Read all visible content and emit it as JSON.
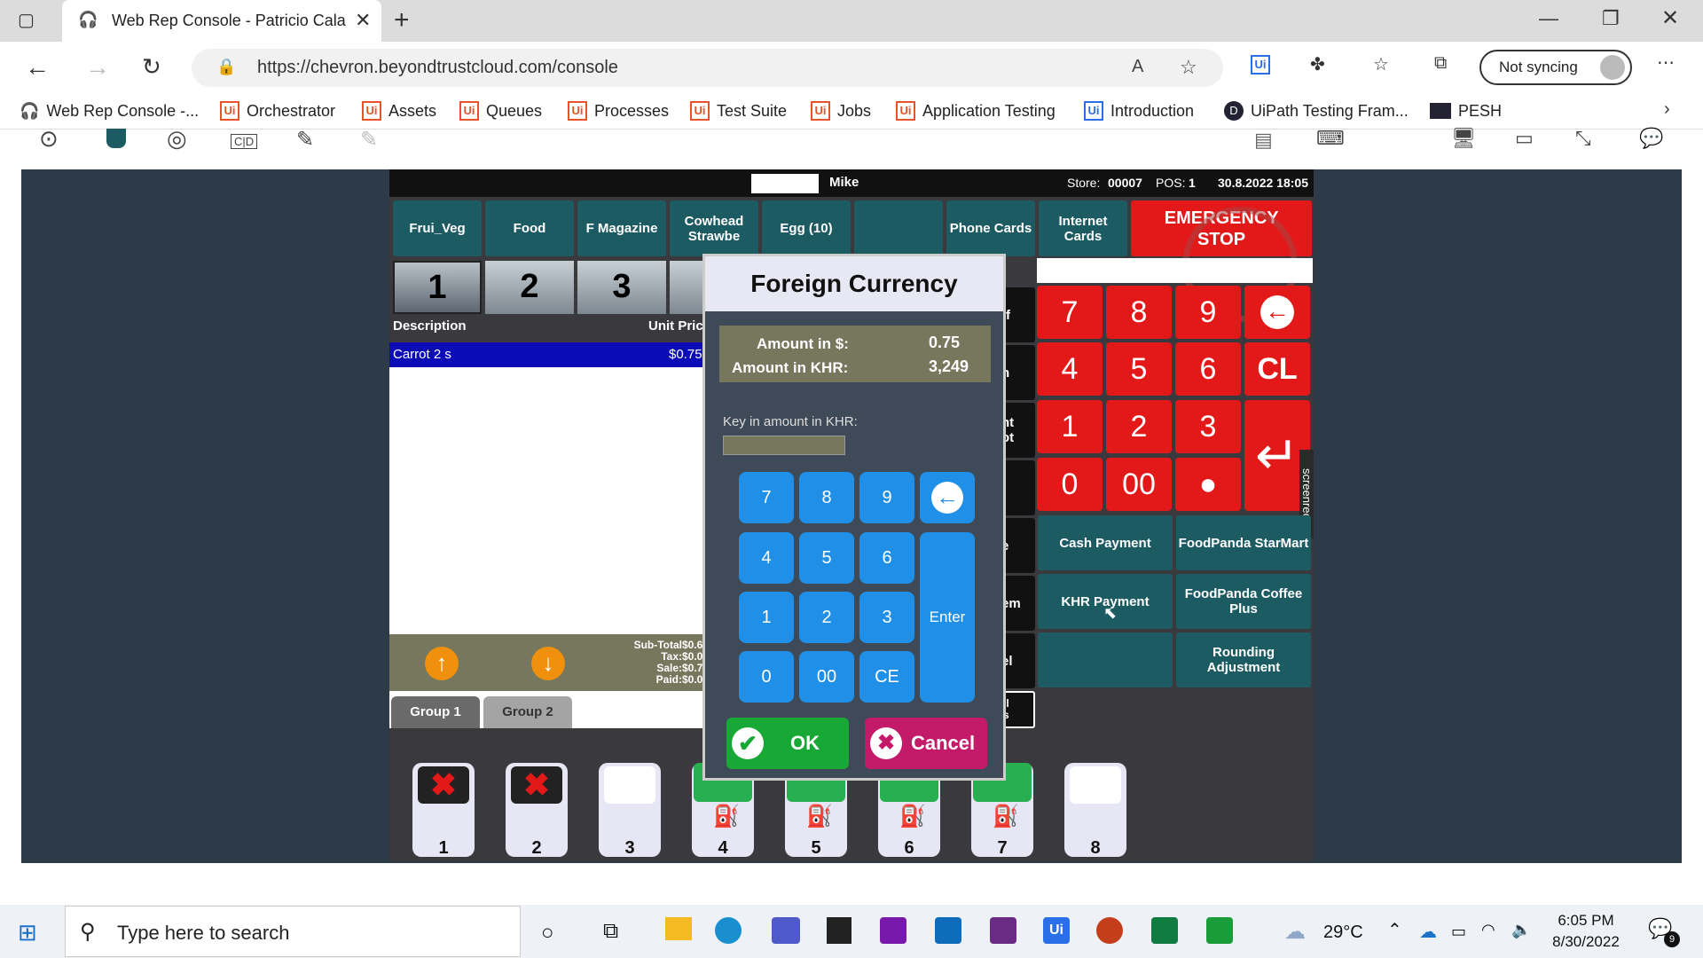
{
  "browser": {
    "tab_title": "Web Rep Console - Patricio Cala",
    "url": "https://chevron.beyondtrustcloud.com/console",
    "sync_label": "Not syncing",
    "bookmarks": [
      "Web Rep Console -...",
      "Orchestrator",
      "Assets",
      "Queues",
      "Processes",
      "Test Suite",
      "Jobs",
      "Application Testing",
      "Introduction",
      "UiPath Testing Fram...",
      "PESH"
    ]
  },
  "pos": {
    "header": {
      "user": "Mike",
      "store_label": "Store:",
      "store": "00007",
      "pos_label": "POS:",
      "pos": "1",
      "datetime": "30.8.2022 18:05"
    },
    "categories": [
      "Frui_Veg",
      "Food",
      "F Magazine",
      "Cowhead Strawbe",
      "Egg (10)",
      "",
      "Phone Cards",
      "Internet Cards"
    ],
    "emergency": "EMERGENCY STOP",
    "terminals": [
      "1",
      "2",
      "3"
    ],
    "list_headers": {
      "description": "Description",
      "unit_price": "Unit Pric"
    },
    "items": [
      {
        "description": "Carrot 2 s",
        "price": "$0.75"
      }
    ],
    "totals": {
      "subtotal_label": "Sub-Total",
      "subtotal": "$0.6",
      "tax_label": "Tax:",
      "tax": "$0.0",
      "sale_label": "Sale:",
      "sale": "$0.7",
      "paid_label": "Paid:",
      "paid": "$0.0"
    },
    "groups": [
      "Group 1",
      "Group 2"
    ],
    "numpad": [
      "7",
      "8",
      "9",
      "4",
      "5",
      "6",
      "CL",
      "1",
      "2",
      "3",
      "0",
      "00",
      "●"
    ],
    "side_partial": [
      "ff",
      "n",
      "nt\not",
      "e",
      "em",
      "el",
      "ll\ns"
    ],
    "pay_buttons": [
      "Cash Payment",
      "FoodPanda StarMart",
      "KHR Payment",
      "FoodPanda Coffee Plus",
      "",
      "Rounding Adjustment"
    ],
    "pumps": [
      "1",
      "2",
      "3",
      "4",
      "5",
      "6",
      "7",
      "8"
    ],
    "screenrec": "screenrec"
  },
  "dialog": {
    "title": "Foreign Currency",
    "amount_usd_label": "Amount in $:",
    "amount_usd": "0.75",
    "amount_khr_label": "Amount in KHR:",
    "amount_khr": "3,249",
    "key_label": "Key in amount in KHR:",
    "keys": [
      "7",
      "8",
      "9",
      "4",
      "5",
      "6",
      "1",
      "2",
      "3",
      "0",
      "00",
      "CE"
    ],
    "enter": "Enter",
    "ok": "OK",
    "cancel": "Cancel"
  },
  "taskbar": {
    "search_placeholder": "Type here to search",
    "weather": "29°C",
    "time": "6:05 PM",
    "date": "8/30/2022",
    "notif": "9"
  }
}
